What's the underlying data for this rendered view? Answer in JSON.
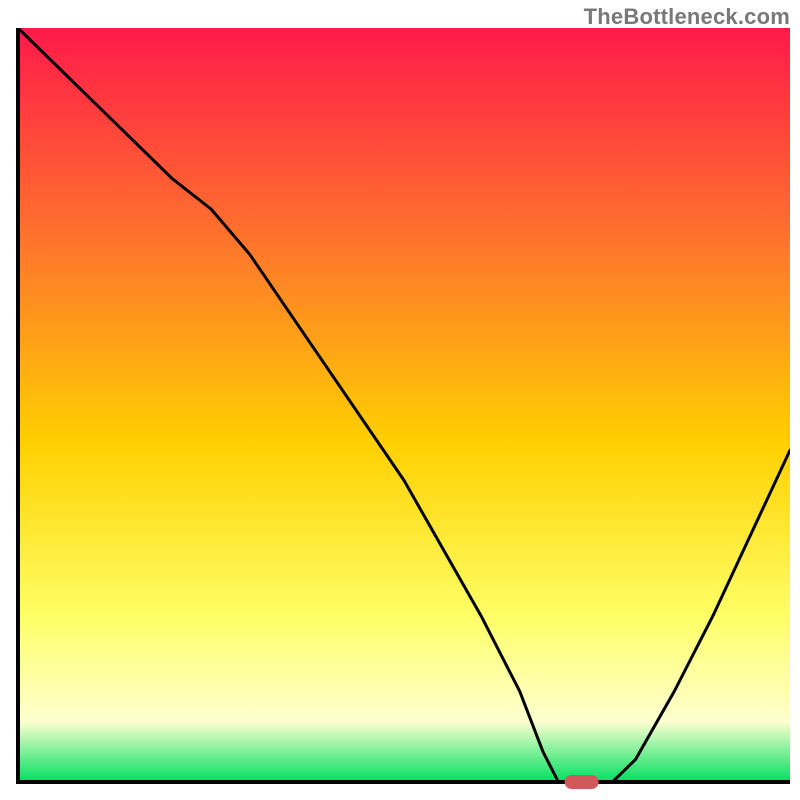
{
  "watermark": "TheBottleneck.com",
  "colors": {
    "gradient_top": "#ff1a4a",
    "gradient_mid1": "#ff7a2a",
    "gradient_mid2": "#ffd000",
    "gradient_mid3": "#ffff66",
    "gradient_mid4": "#fdffd0",
    "gradient_bottom": "#00e060",
    "axis": "#000000",
    "curve": "#000000",
    "marker_fill": "#d05a5a",
    "marker_stroke": "#d05a5a"
  },
  "chart_data": {
    "type": "line",
    "title": "",
    "xlabel": "",
    "ylabel": "",
    "xlim": [
      0,
      100
    ],
    "ylim": [
      0,
      100
    ],
    "series": [
      {
        "name": "bottleneck-curve",
        "x": [
          0,
          10,
          20,
          25,
          30,
          40,
          50,
          60,
          65,
          68,
          70,
          73,
          77,
          80,
          85,
          90,
          100
        ],
        "y": [
          100,
          90,
          80,
          76,
          70,
          55,
          40,
          22,
          12,
          4,
          0,
          0,
          0,
          3,
          12,
          22,
          44
        ]
      }
    ],
    "marker": {
      "name": "optimal-point",
      "x": 73,
      "y": 0,
      "shape": "capsule"
    }
  }
}
